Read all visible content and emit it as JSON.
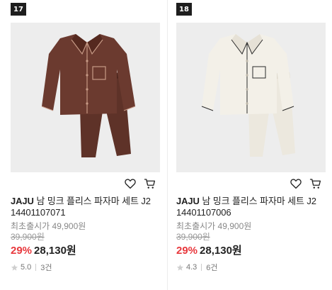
{
  "products": [
    {
      "rank": "17",
      "brand": "JAJU",
      "name": "남 밍크 플리스 파자마 세트 J2",
      "code": "14401107071",
      "launch_label": "최초출시가",
      "launch_price": "49,900원",
      "original_price": "39,900원",
      "discount": "29%",
      "price": "28,130원",
      "rating": "5.0",
      "reviews": "3건",
      "color": "#6b3a2f"
    },
    {
      "rank": "18",
      "brand": "JAJU",
      "name": "남 밍크 플리스 파자마 세트 J2",
      "code": "14401107006",
      "launch_label": "최초출시가",
      "launch_price": "49,900원",
      "original_price": "39,900원",
      "discount": "29%",
      "price": "28,130원",
      "rating": "4.3",
      "reviews": "6건",
      "color": "#f1eee6"
    }
  ],
  "icons": {
    "wishlist": "heart-icon",
    "cart": "cart-icon",
    "rating": "star-icon"
  },
  "colors": {
    "discount": "#e8383d",
    "rank_badge": "#1e1e1e"
  }
}
